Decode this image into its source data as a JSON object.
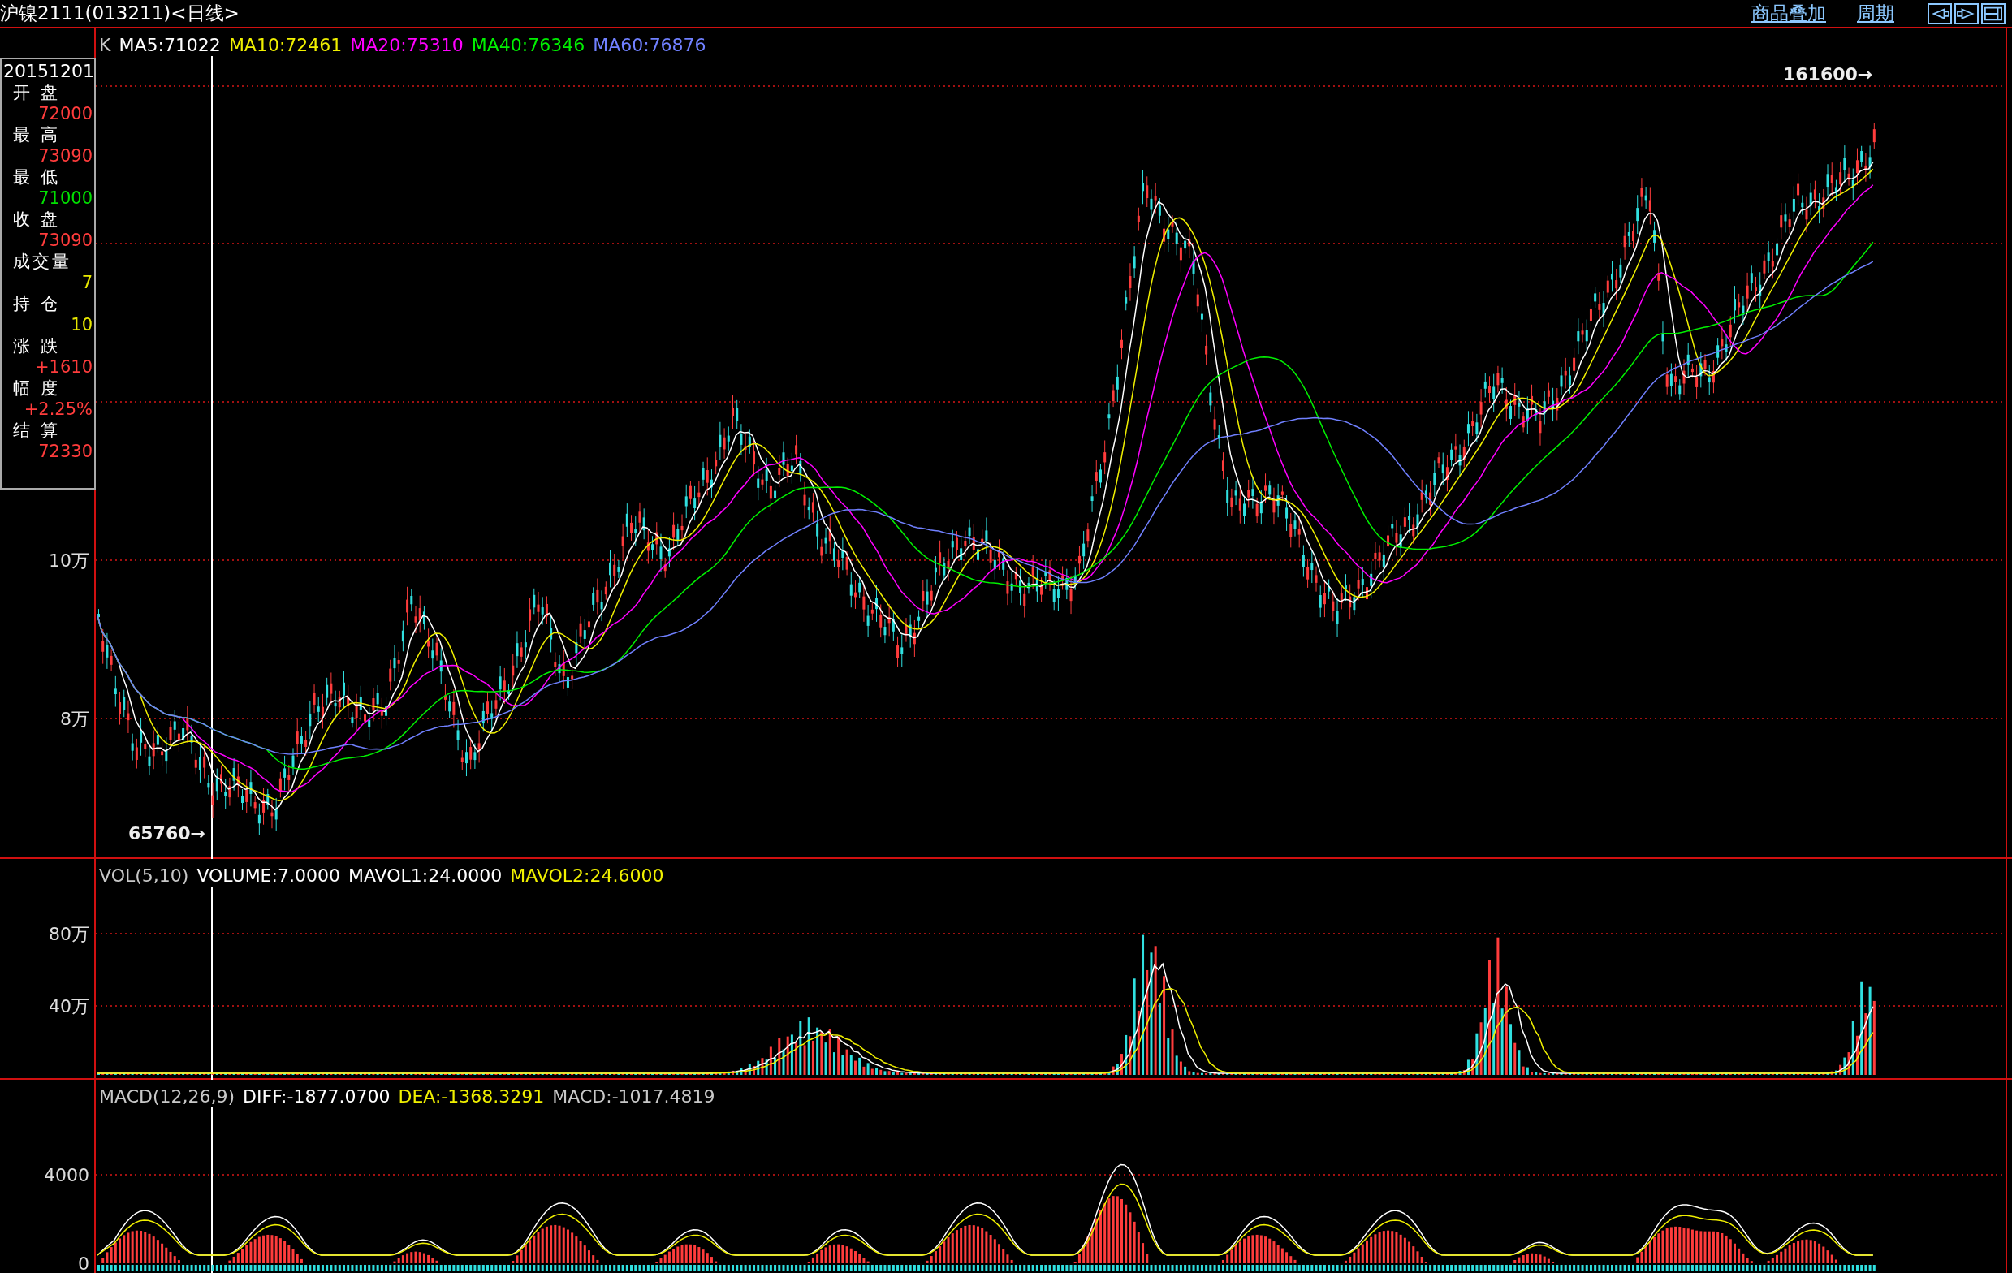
{
  "title": "沪镍2111(013211)<日线>",
  "toolbar_links": [
    "商品叠加",
    "周期"
  ],
  "info_panel": {
    "date": "20151201",
    "fields": [
      {
        "label": "开盘",
        "value": "72000",
        "color": "#ff3c3c"
      },
      {
        "label": "最高",
        "value": "73090",
        "color": "#ff3c3c"
      },
      {
        "label": "最低",
        "value": "71000",
        "color": "#00e000"
      },
      {
        "label": "收盘",
        "value": "73090",
        "color": "#ff3c3c"
      },
      {
        "label": "成交量",
        "value": "7",
        "color": "#e8e800"
      },
      {
        "label": "持仓",
        "value": "10",
        "color": "#e8e800"
      },
      {
        "label": "涨跌",
        "value": "+1610",
        "color": "#ff3c3c"
      },
      {
        "label": "幅度",
        "value": "+2.25%",
        "color": "#ff3c3c"
      },
      {
        "label": "结算",
        "value": "72330",
        "color": "#ff3c3c"
      }
    ]
  },
  "main_pane": {
    "legend": [
      {
        "text": "K",
        "color": "#c8c8c8"
      },
      {
        "text": "MA5:71022",
        "color": "#ffffff"
      },
      {
        "text": "MA10:72461",
        "color": "#f0f000"
      },
      {
        "text": "MA20:75310",
        "color": "#ff00ff"
      },
      {
        "text": "MA40:76346",
        "color": "#00f000"
      },
      {
        "text": "MA60:76876",
        "color": "#7080ff"
      }
    ],
    "y_labels": [
      "10万",
      "8万"
    ],
    "high_marker": "161600→",
    "low_marker": "65760→"
  },
  "volume_pane": {
    "legend": [
      {
        "text": "VOL(5,10)",
        "color": "#c8c8c8"
      },
      {
        "text": "VOLUME:7.0000",
        "color": "#ffffff"
      },
      {
        "text": "MAVOL1:24.0000",
        "color": "#ffffff"
      },
      {
        "text": "MAVOL2:24.6000",
        "color": "#f0f000"
      }
    ],
    "y_labels": [
      "80万",
      "40万"
    ]
  },
  "macd_pane": {
    "legend": [
      {
        "text": "MACD(12,26,9)",
        "color": "#c8c8c8"
      },
      {
        "text": "DIFF:-1877.0700",
        "color": "#ffffff"
      },
      {
        "text": "DEA:-1368.3291",
        "color": "#f0f000"
      },
      {
        "text": "MACD:-1017.4819",
        "color": "#c8c8c8"
      }
    ],
    "y_labels": [
      "4000",
      "0"
    ]
  }
}
